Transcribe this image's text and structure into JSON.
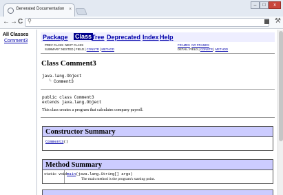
{
  "browser": {
    "tab_title": "Generated Documentation",
    "tab_close": "×",
    "nav": {
      "back": "←",
      "forward": "→",
      "reload": "C"
    },
    "omnibox_icon": "search-icon",
    "window": {
      "minimize": "–",
      "maximize": "□",
      "close": "x"
    },
    "wrench": "wrench-icon"
  },
  "left_frame": {
    "heading": "All Classes",
    "items": [
      "Comment3"
    ]
  },
  "navbar": {
    "items": [
      "Package",
      "Class",
      "Tree",
      "Deprecated",
      "Index",
      "Help"
    ],
    "current": "Class"
  },
  "subnav": {
    "prev_class": "PREV CLASS",
    "next_class": "NEXT CLASS",
    "frames": "FRAMES",
    "no_frames": "NO FRAMES",
    "summary_prefix": "SUMMARY: NESTED | FIELD |",
    "summary_constr": "CONSTR",
    "summary_method": "METHOD",
    "detail_prefix": "DETAIL: FIELD |",
    "detail_constr": "CONSTR",
    "detail_method": "METHOD",
    "sep": "|"
  },
  "class_doc": {
    "title": "Class Comment3",
    "hierarchy_root": "java.lang.Object",
    "hierarchy_child": "Comment3",
    "decl_line1": "public class Comment3",
    "decl_line2": "extends java.lang.Object",
    "description": "This class creates a program that calculates company payroll."
  },
  "constructor_summary": {
    "heading": "Constructor Summary",
    "rows": [
      {
        "name": "Comment3",
        "params": "()"
      }
    ]
  },
  "method_summary": {
    "heading": "Method Summary",
    "rows": [
      {
        "modifier": "static void",
        "name": "main",
        "params": "(java.lang.String[] args)",
        "description": "The main method is the program's starting point."
      }
    ]
  },
  "colors": {
    "navbar_bg": "#eeeeff",
    "table_header_bg": "#ccccff",
    "current_tab_bg": "#00008b",
    "link": "#0000aa"
  }
}
